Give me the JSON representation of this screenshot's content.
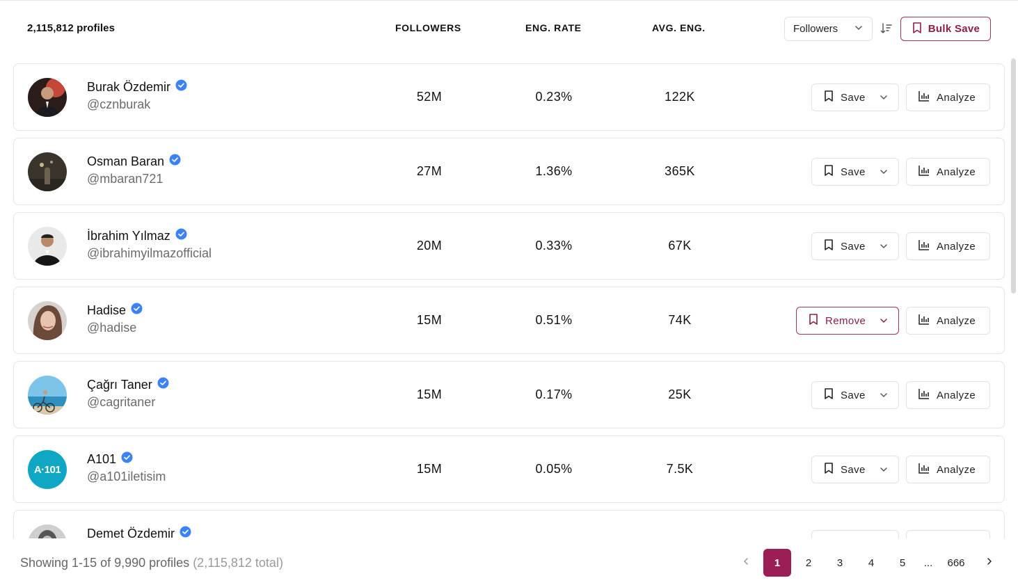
{
  "header": {
    "profiles_count": "2,115,812 profiles",
    "columns": {
      "followers": "FOLLOWERS",
      "eng_rate": "ENG. RATE",
      "avg_eng": "AVG. ENG."
    },
    "sort_select": {
      "value": "Followers"
    },
    "bulk_save_label": "Bulk Save"
  },
  "buttons": {
    "save": "Save",
    "remove": "Remove",
    "analyze": "Analyze"
  },
  "rows": [
    {
      "name": "Burak Özdemir",
      "handle": "@cznburak",
      "followers": "52M",
      "eng_rate": "0.23%",
      "avg_eng": "122K",
      "saved": false
    },
    {
      "name": "Osman Baran",
      "handle": "@mbaran721",
      "followers": "27M",
      "eng_rate": "1.36%",
      "avg_eng": "365K",
      "saved": false
    },
    {
      "name": "İbrahim Yılmaz",
      "handle": "@ibrahimyilmazofficial",
      "followers": "20M",
      "eng_rate": "0.33%",
      "avg_eng": "67K",
      "saved": false
    },
    {
      "name": "Hadise",
      "handle": "@hadise",
      "followers": "15M",
      "eng_rate": "0.51%",
      "avg_eng": "74K",
      "saved": true
    },
    {
      "name": "Çağrı Taner",
      "handle": "@cagritaner",
      "followers": "15M",
      "eng_rate": "0.17%",
      "avg_eng": "25K",
      "saved": false
    },
    {
      "name": "A101",
      "handle": "@a101iletisim",
      "followers": "15M",
      "eng_rate": "0.05%",
      "avg_eng": "7.5K",
      "saved": false
    },
    {
      "name": "Demet Özdemir",
      "handle": "",
      "followers": "",
      "eng_rate": "",
      "avg_eng": "",
      "saved": false
    }
  ],
  "logo_text": "A·101",
  "footer": {
    "showing": "Showing 1-15 of 9,990 profiles",
    "total": "(2,115,812 total)",
    "pages": [
      "1",
      "2",
      "3",
      "4",
      "5"
    ],
    "ellipsis": "...",
    "last_page": "666",
    "current_page": "1"
  },
  "colors": {
    "accent": "#9b1f56",
    "verified": "#3b82f6",
    "border": "#e4e4e4"
  }
}
